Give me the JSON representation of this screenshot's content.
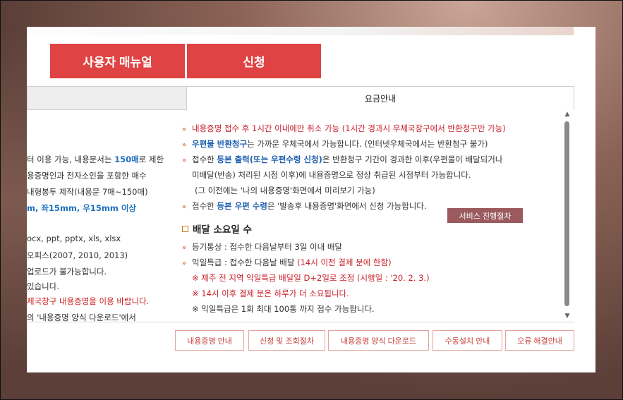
{
  "buttons": {
    "manual": "사용자 매뉴얼",
    "apply": "신청"
  },
  "tabs": {
    "fee_info": "요금안내"
  },
  "left_col": {
    "l1": "터 이용 가능, 내용문서는 ",
    "l1b": "150매",
    "l1c": "로 제한",
    "l2": "용증명인과 전자소인을 포함한 매수",
    "l3": "내형봉투 제작(내용문 7매~150매)",
    "l4": "m, 좌15mm, 우15mm 이상",
    "l5": "ocx, ppt, pptx, xls, xlsx",
    "l6": "오피스(2007, 2010, 2013)",
    "l7": "업로드가 불가능합니다.",
    "l8": "있습니다.",
    "l9a": "체국창구 ",
    "l9b": "내용증명을 이용 바랍니다.",
    "l10": "의 '내용증명 양식 다운로드'에서"
  },
  "content": {
    "b1": "내용증명 접수 후 1시간 이내에만 취소 가능 (1시간 경과시 우체국창구에서 반환청구만 가능)",
    "b2a": "우편물 반환청구",
    "b2b": "는 가까운 우체국에서 가능합니다. (인터넷우체국에서는 반환청구 불가)",
    "b3a": "접수한 ",
    "b3b": "등본 출력(또는 우편수령 신청)",
    "b3c": "은 반환청구 기간이 경과한 이후(우편물이 배달되거나",
    "b3d": "미배달(반송) 처리된 시점 이후)에 내용증명으로 정상 취급된 시점부터 가능합니다.",
    "b3e": "(그 이전에는 '나의 내용증명'화면에서 미리보기 가능)",
    "b4a": "접수한 ",
    "b4b": "등본 우편 수령",
    "b4c": "은 '발송후 내용증명'화면에서 신청 가능합니다.",
    "service_btn": "서비스 진행절차",
    "section_title": "배달 소요일 수",
    "d1": "등기통상 : 접수한 다음날부터 3일 이내 배달",
    "d2a": "익일특급 : 접수한 다음날 배달 ",
    "d2b": "(14시 이전 결제 분에 한함)",
    "n1": "※ 제주 전 지역 익일특급 배달일 D+2일로 조정 (시행일 : '20. 2. 3.)",
    "n2": "※ 14시 이후 결제 분은 하루가 더 소요됩니다.",
    "n3": "※ 익일특급은 1회 최대 100통 까지 접수 가능합니다."
  },
  "bottom_links": [
    "내용증명 안내",
    "신청 및 조회절차",
    "내용증명 양식 다운로드",
    "수동설치 안내",
    "오류 해결안내"
  ],
  "colors": {
    "primary_red": "#e04343",
    "service_btn": "#9a5a5e",
    "link_border": "#e2a49c",
    "link_text": "#c8443e"
  }
}
